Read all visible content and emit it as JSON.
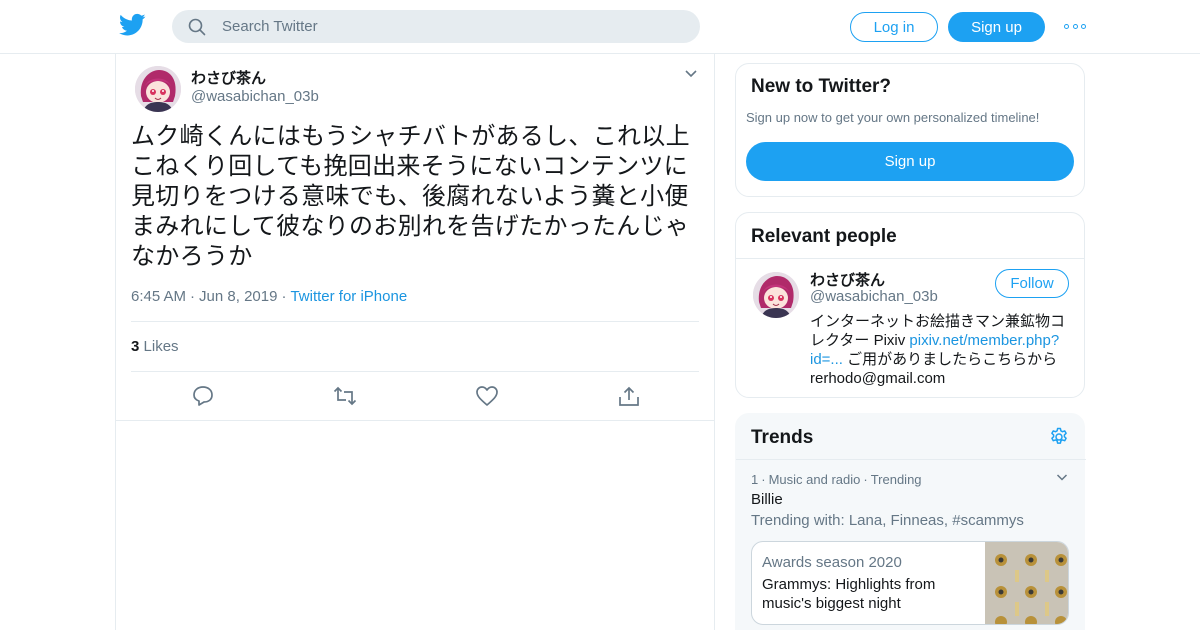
{
  "header": {
    "search_placeholder": "Search Twitter",
    "login_label": "Log in",
    "signup_label": "Sign up",
    "brand_color": "#1da1f2"
  },
  "tweet": {
    "author_name": "わさび茶ん",
    "author_handle": "@wasabichan_03b",
    "text": "ムク崎くんにはもうシャチバトがあるし、これ以上こねくり回しても挽回出来そうにないコンテンツに見切りをつける意味でも、後腐れないよう糞と小便まみれにして彼なりのお別れを告げたかったんじゃなかろうか",
    "time": "6:45 AM",
    "date": "Jun 8, 2019",
    "source": "Twitter for iPhone",
    "likes_count": "3",
    "likes_label": "Likes",
    "actions": [
      "reply-icon",
      "retweet-icon",
      "like-icon",
      "share-icon"
    ]
  },
  "sidebar": {
    "new_to_twitter": {
      "title": "New to Twitter?",
      "subtitle": "Sign up now to get your own personalized timeline!",
      "button_label": "Sign up"
    },
    "relevant_people": {
      "title": "Relevant people",
      "name": "わさび茶ん",
      "handle": "@wasabichan_03b",
      "follow_label": "Follow",
      "bio_prefix": "インターネットお絵描きマン兼鉱物コレクター Pixiv ",
      "bio_link": "pixiv.net/member.php?id=...",
      "bio_suffix": " ご用がありましたらこちらから rerhodo@gmail.com"
    },
    "trends": {
      "title": "Trends",
      "rank": "1",
      "category": "Music and radio",
      "status": "Trending",
      "name": "Billie",
      "trending_with": "Trending with: Lana, Finneas, #scammys",
      "moment_category": "Awards season 2020",
      "moment_title": "Grammys: Highlights from music's biggest night"
    }
  }
}
